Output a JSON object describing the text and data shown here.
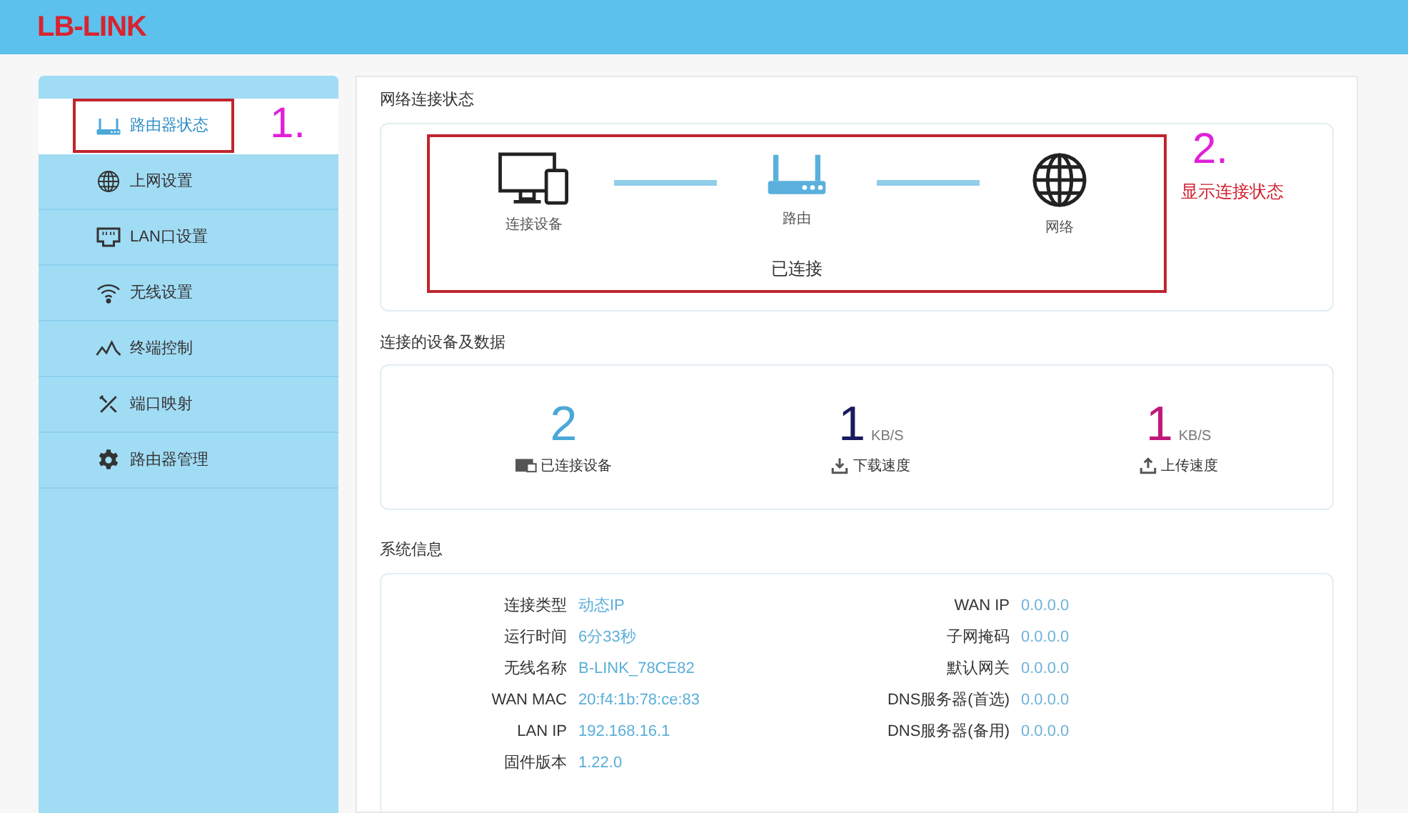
{
  "header": {
    "logo": "LB-LINK"
  },
  "sidebar": {
    "items": [
      {
        "label": "路由器状态",
        "kind": "router",
        "selected": true
      },
      {
        "label": "上网设置",
        "kind": "globe",
        "selected": false
      },
      {
        "label": "LAN口设置",
        "kind": "lan",
        "selected": false
      },
      {
        "label": "无线设置",
        "kind": "wifi",
        "selected": false
      },
      {
        "label": "终端控制",
        "kind": "wave",
        "selected": false
      },
      {
        "label": "端口映射",
        "kind": "tools",
        "selected": false
      },
      {
        "label": "路由器管理",
        "kind": "gear",
        "selected": false
      }
    ]
  },
  "network_status": {
    "title": "网络连接状态",
    "nodes": [
      {
        "label": "连接设备",
        "kind": "devices"
      },
      {
        "label": "路由",
        "kind": "router"
      },
      {
        "label": "网络",
        "kind": "globe"
      }
    ],
    "status": "已连接"
  },
  "devices_data": {
    "title": "连接的设备及数据",
    "stats": [
      {
        "value": "2",
        "label": "已连接设备",
        "kind": "devices",
        "color": "#4aa8d8"
      },
      {
        "value": "1",
        "unit": "KB/S",
        "label": "下载速度",
        "kind": "download",
        "color": "#1a1a5e"
      },
      {
        "value": "1",
        "unit": "KB/S",
        "label": "上传速度",
        "kind": "upload",
        "color": "#c0187a"
      }
    ]
  },
  "system_info": {
    "title": "系统信息",
    "left": [
      {
        "label": "连接类型",
        "value": "动态IP"
      },
      {
        "label": "运行时间",
        "value": "6分33秒"
      },
      {
        "label": "无线名称",
        "value": "B-LINK_78CE82"
      },
      {
        "label": "WAN MAC",
        "value": "20:f4:1b:78:ce:83"
      },
      {
        "label": "LAN IP",
        "value": "192.168.16.1"
      },
      {
        "label": "固件版本",
        "value": "1.22.0"
      }
    ],
    "right": [
      {
        "label": "WAN IP",
        "value": "0.0.0.0"
      },
      {
        "label": "子网掩码",
        "value": "0.0.0.0"
      },
      {
        "label": "默认网关",
        "value": "0.0.0.0"
      },
      {
        "label": "DNS服务器(首选)",
        "value": "0.0.0.0"
      },
      {
        "label": "DNS服务器(备用)",
        "value": "0.0.0.0"
      }
    ]
  },
  "annotations": [
    {
      "number": "1."
    },
    {
      "number": "2.",
      "text": "显示连接状态"
    }
  ]
}
